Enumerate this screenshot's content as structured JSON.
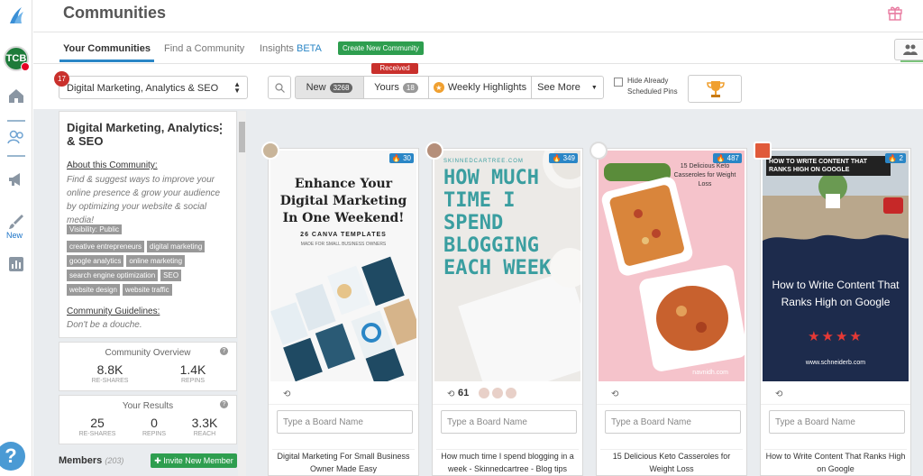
{
  "header": {
    "title": "Communities"
  },
  "tabs": {
    "your_communities": "Your Communities",
    "find_community": "Find a Community",
    "insights": "Insights",
    "insights_badge": "BETA",
    "create_button": "Create New Community"
  },
  "rail": {
    "avatar_text": "TCB",
    "new_label": "New",
    "help": "?"
  },
  "filter": {
    "badge_count": "17",
    "selected_community": "Digital Marketing, Analytics & SEO",
    "received_tooltip": "Received",
    "segments": {
      "new_label": "New",
      "new_count": "3268",
      "yours_label": "Yours",
      "yours_count": "18",
      "weekly_label": "Weekly Highlights",
      "more_label": "See More"
    },
    "hide_scheduled_label": "Hide Already Scheduled Pins"
  },
  "about": {
    "title": "Digital Marketing, Analytics & SEO",
    "about_label": "About this Community:",
    "about_text": "Find & suggest ways to improve your online presence & grow your audience by optimizing your website & social media!",
    "visibility": "Visibility: Public",
    "tags": [
      "creative entrepreneurs",
      "digital marketing",
      "google analytics",
      "online marketing",
      "search engine optimization",
      "SEO",
      "website design",
      "website traffic"
    ],
    "guidelines_label": "Community Guidelines:",
    "guidelines_text": "Don't be a douche."
  },
  "overview": {
    "title": "Community Overview",
    "reshares_value": "8.8K",
    "reshares_label": "RE-SHARES",
    "repins_value": "1.4K",
    "repins_label": "REPINS"
  },
  "results": {
    "title": "Your Results",
    "reshares_value": "25",
    "reshares_label": "RE-SHARES",
    "repins_value": "0",
    "repins_label": "REPINS",
    "reach_value": "3.3K",
    "reach_label": "REACH"
  },
  "members": {
    "label": "Members",
    "count": "(203)",
    "invite_button": "Invite New Member"
  },
  "pins": [
    {
      "score": "30",
      "headline": "Enhance Your Digital Marketing In One Weekend!",
      "subline": "26 CANVA TEMPLATES",
      "subline2": "MADE FOR SMALL BUSINESS OWNERS",
      "board_placeholder": "Type a Board Name",
      "description": "Digital Marketing For Small Business Owner Made Easy"
    },
    {
      "score": "349",
      "site": "SKINNEDCARTREE.COM",
      "headline": "HOW MUCH TIME I SPEND BLOGGING EACH WEEK",
      "repin_count": "61",
      "board_placeholder": "Type a Board Name",
      "description": "How much time I spend blogging in a week - Skinnedcartree - Blog tips"
    },
    {
      "score": "487",
      "headline": "15 Delicious Keto Casseroles for Weight Loss",
      "site": "navnidh.com",
      "board_placeholder": "Type a Board Name",
      "description": "15 Delicious Keto Casseroles for Weight Loss"
    },
    {
      "score": "2",
      "band": "HOW TO WRITE CONTENT THAT RANKS HIGH ON GOOGLE",
      "headline": "How to Write Content That Ranks High on Google",
      "stars": "★★★★",
      "site": "www.schneiderb.com",
      "board_placeholder": "Type a Board Name",
      "description": "How to Write Content That Ranks High on Google"
    }
  ],
  "colors": {
    "accent_blue": "#2a86c6",
    "brand_green": "#2e9e4f",
    "badge_red": "#c9302c",
    "panel_grey": "#e9ecef"
  }
}
